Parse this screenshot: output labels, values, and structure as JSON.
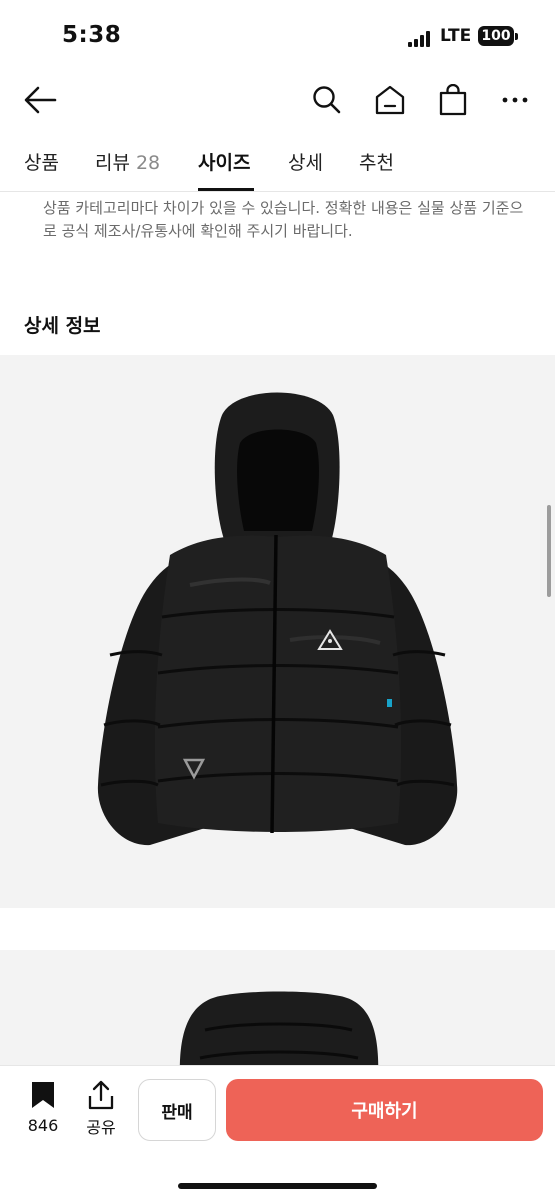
{
  "status_bar": {
    "time": "5:38",
    "network": "LTE",
    "battery": "100"
  },
  "nav": {
    "icons": [
      "back-arrow-icon",
      "search-icon",
      "home-icon",
      "shopping-bag-icon",
      "more-icon"
    ]
  },
  "tabs": [
    {
      "label": "상품"
    },
    {
      "label": "리뷰",
      "count": "28"
    },
    {
      "label": "사이즈",
      "active": true
    },
    {
      "label": "상세"
    },
    {
      "label": "추천"
    }
  ],
  "notice": {
    "text": "상품 카테고리마다 차이가 있을 수 있습니다. 정확한 내용은 실물 상품 기준으로 공식 제조사/유통사에 확인해 주시기 바랍니다."
  },
  "detail": {
    "title": "상세 정보",
    "product_icon": "puffer-jacket-image"
  },
  "bottom_bar": {
    "bookmark_count": "846",
    "share_label": "공유",
    "sell_label": "판매",
    "buy_label": "구매하기"
  },
  "colors": {
    "buy_button": "#ee6357",
    "image_background": "#f3f3f3"
  }
}
